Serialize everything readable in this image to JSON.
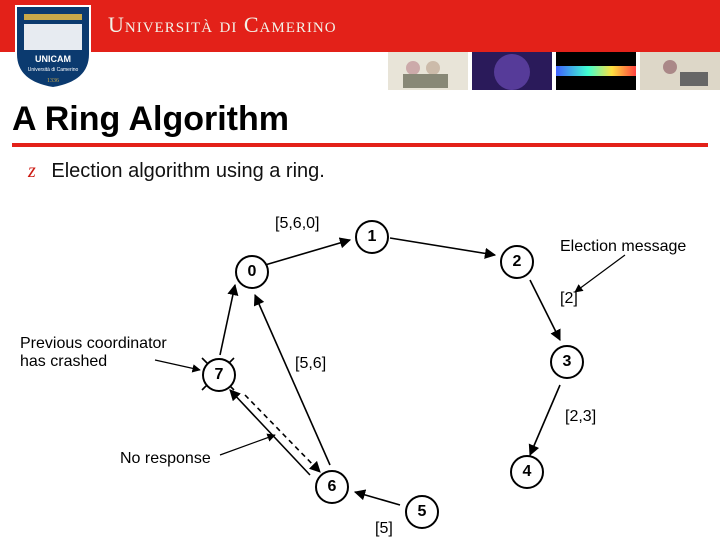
{
  "header": {
    "university": "Università di Camerino"
  },
  "title": "A Ring Algorithm",
  "bullet": {
    "marker": "z",
    "text": "Election algorithm using a ring."
  },
  "diagram": {
    "nodes": {
      "n0": "0",
      "n1": "1",
      "n2": "2",
      "n3": "3",
      "n4": "4",
      "n5": "5",
      "n6": "6",
      "n7": "7"
    },
    "edge_labels": {
      "e560": "[5,6,0]",
      "e2": "[2]",
      "e56": "[5,6]",
      "e23": "[2,3]",
      "e5": "[5]"
    },
    "annotations": {
      "crashed": "Previous coordinator\nhas crashed",
      "noresp": "No response",
      "election": "Election message"
    }
  }
}
